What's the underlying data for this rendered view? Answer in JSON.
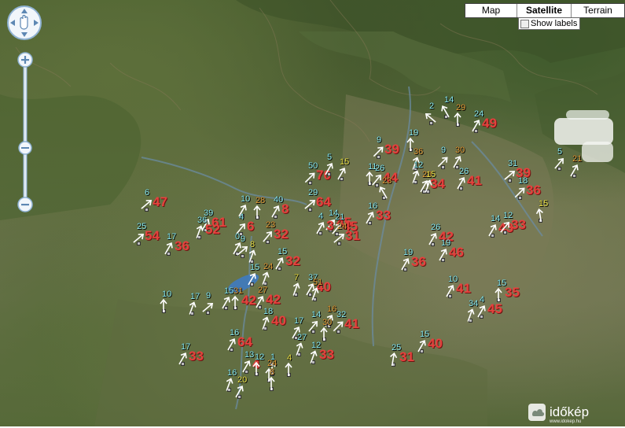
{
  "map_type": {
    "options": [
      "Map",
      "Satellite",
      "Terrain"
    ],
    "active": "Satellite"
  },
  "show_labels": {
    "label": "Show labels",
    "checked": false
  },
  "logo": {
    "text": "időkép",
    "subtext": "www.idokep.hu"
  },
  "colors": {
    "gust": "#e5413d",
    "speed_cyan": "#8ff0f4",
    "speed_orange": "#e9a43d",
    "speed_yellow": "#f3ea4c"
  },
  "stations": [
    {
      "s": "14",
      "c": "cyan",
      "g": ""
    },
    {
      "s": "2",
      "c": "cyan",
      "g": ""
    },
    {
      "s": "29",
      "c": "orange",
      "g": ""
    },
    {
      "s": "24",
      "c": "cyan",
      "g": "49"
    },
    {
      "s": "19",
      "c": "cyan",
      "g": ""
    },
    {
      "s": "9",
      "c": "cyan",
      "g": "39"
    },
    {
      "s": "36",
      "c": "orange",
      "g": ""
    },
    {
      "s": "9",
      "c": "cyan",
      "g": ""
    },
    {
      "s": "30",
      "c": "orange",
      "g": ""
    },
    {
      "s": "5",
      "c": "cyan",
      "g": ""
    },
    {
      "s": "21",
      "c": "orange",
      "g": ""
    },
    {
      "s": "31",
      "c": "cyan",
      "g": "39"
    },
    {
      "s": "50",
      "c": "cyan",
      "g": "70"
    },
    {
      "s": "5",
      "c": "cyan",
      "g": ""
    },
    {
      "s": "15",
      "c": "yellow",
      "g": ""
    },
    {
      "s": "11",
      "c": "cyan",
      "g": ""
    },
    {
      "s": "26",
      "c": "cyan",
      "g": "44"
    },
    {
      "s": "12",
      "c": "cyan",
      "g": ""
    },
    {
      "s": "23",
      "c": "orange",
      "g": ""
    },
    {
      "s": "28",
      "c": "orange",
      "g": "34"
    },
    {
      "s": "26",
      "c": "cyan",
      "g": "41"
    },
    {
      "s": "15",
      "c": "yellow",
      "g": ""
    },
    {
      "s": "18",
      "c": "cyan",
      "g": "36"
    },
    {
      "s": "15",
      "c": "yellow",
      "g": ""
    },
    {
      "s": "6",
      "c": "cyan",
      "g": "47"
    },
    {
      "s": "10",
      "c": "cyan",
      "g": ""
    },
    {
      "s": "28",
      "c": "orange",
      "g": ""
    },
    {
      "s": "40",
      "c": "cyan",
      "g": "8"
    },
    {
      "s": "29",
      "c": "cyan",
      "g": "64"
    },
    {
      "s": "16",
      "c": "cyan",
      "g": "33"
    },
    {
      "s": "14",
      "c": "cyan",
      "g": "45"
    },
    {
      "s": "39",
      "c": "cyan",
      "g": "61"
    },
    {
      "s": "36",
      "c": "cyan",
      "g": "52"
    },
    {
      "s": "4",
      "c": "cyan",
      "g": "6"
    },
    {
      "s": "23",
      "c": "orange",
      "g": "32"
    },
    {
      "s": "4",
      "c": "cyan",
      "g": "3"
    },
    {
      "s": "21",
      "c": "cyan",
      "g": "45"
    },
    {
      "s": "24",
      "c": "orange",
      "g": "31"
    },
    {
      "s": "25",
      "c": "cyan",
      "g": "54"
    },
    {
      "s": "17",
      "c": "cyan",
      "g": "36"
    },
    {
      "s": "26",
      "c": "cyan",
      "g": "42"
    },
    {
      "s": "14",
      "c": "cyan",
      "g": "43"
    },
    {
      "s": "12",
      "c": "cyan",
      "g": "33"
    },
    {
      "s": "0",
      "c": "cyan",
      "g": ""
    },
    {
      "s": "9",
      "c": "cyan",
      "g": ""
    },
    {
      "s": "8",
      "c": "yellow",
      "g": ""
    },
    {
      "s": "15",
      "c": "cyan",
      "g": "32"
    },
    {
      "s": "19",
      "c": "cyan",
      "g": "36"
    },
    {
      "s": "19",
      "c": "cyan",
      "g": "46"
    },
    {
      "s": "24",
      "c": "orange",
      "g": ""
    },
    {
      "s": "15",
      "c": "cyan",
      "g": ""
    },
    {
      "s": "7",
      "c": "yellow",
      "g": ""
    },
    {
      "s": "37",
      "c": "cyan",
      "g": "40"
    },
    {
      "s": "51",
      "c": "orange",
      "g": ""
    },
    {
      "s": "10",
      "c": "cyan",
      "g": "41"
    },
    {
      "s": "15",
      "c": "cyan",
      "g": "35"
    },
    {
      "s": "10",
      "c": "cyan",
      "g": ""
    },
    {
      "s": "17",
      "c": "cyan",
      "g": ""
    },
    {
      "s": "9",
      "c": "cyan",
      "g": ""
    },
    {
      "s": "15",
      "c": "cyan",
      "g": ""
    },
    {
      "s": "31",
      "c": "orange",
      "g": "42"
    },
    {
      "s": "27",
      "c": "orange",
      "g": "42"
    },
    {
      "s": "34",
      "c": "cyan",
      "g": ""
    },
    {
      "s": "4",
      "c": "cyan",
      "g": "45"
    },
    {
      "s": "18",
      "c": "cyan",
      "g": "40"
    },
    {
      "s": "32",
      "c": "cyan",
      "g": "41"
    },
    {
      "s": "14",
      "c": "cyan",
      "g": ""
    },
    {
      "s": "16",
      "c": "orange",
      "g": ""
    },
    {
      "s": "17",
      "c": "cyan",
      "g": ""
    },
    {
      "s": "30",
      "c": "orange",
      "g": ""
    },
    {
      "s": "16",
      "c": "cyan",
      "g": "64"
    },
    {
      "s": "17",
      "c": "cyan",
      "g": "33"
    },
    {
      "s": "27",
      "c": "cyan",
      "g": ""
    },
    {
      "s": "12",
      "c": "cyan",
      "g": "33"
    },
    {
      "s": "25",
      "c": "cyan",
      "g": "31"
    },
    {
      "s": "15",
      "c": "cyan",
      "g": "40"
    },
    {
      "s": "13",
      "c": "cyan",
      "g": "4"
    },
    {
      "s": "12",
      "c": "cyan",
      "g": ""
    },
    {
      "s": "1",
      "c": "cyan",
      "g": ""
    },
    {
      "s": "24",
      "c": "orange",
      "g": ""
    },
    {
      "s": "4",
      "c": "yellow",
      "g": ""
    },
    {
      "s": "8",
      "c": "orange",
      "g": ""
    },
    {
      "s": "16",
      "c": "cyan",
      "g": ""
    },
    {
      "s": "20",
      "c": "yellow",
      "g": ""
    }
  ]
}
